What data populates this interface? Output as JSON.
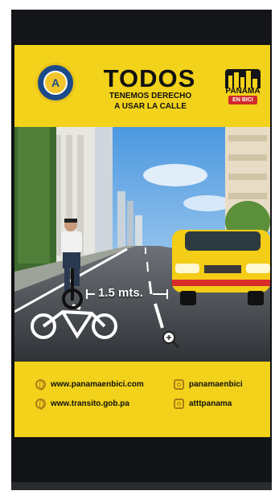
{
  "header": {
    "title": "TODOS",
    "subtitle_line1": "TENEMOS DERECHO",
    "subtitle_line2": "A USAR LA CALLE"
  },
  "brand_logo": {
    "word": "PANAMA",
    "badge": "EN BICI"
  },
  "scene": {
    "distance_label": "1.5 mts."
  },
  "footer": {
    "links": [
      {
        "icon": "globe-icon",
        "text": "www.panamaenbici.com"
      },
      {
        "icon": "globe-icon",
        "text": "www.transito.gob.pa"
      }
    ],
    "socials": [
      {
        "icon": "instagram-icon",
        "text": "panamaenbici"
      },
      {
        "icon": "instagram-icon",
        "text": "atttpanama"
      }
    ]
  },
  "colors": {
    "poster_yellow": "#f2d21a",
    "frame_dark": "#111214",
    "taxi_yellow": "#f4cd16",
    "sky_blue": "#6db0e8"
  }
}
